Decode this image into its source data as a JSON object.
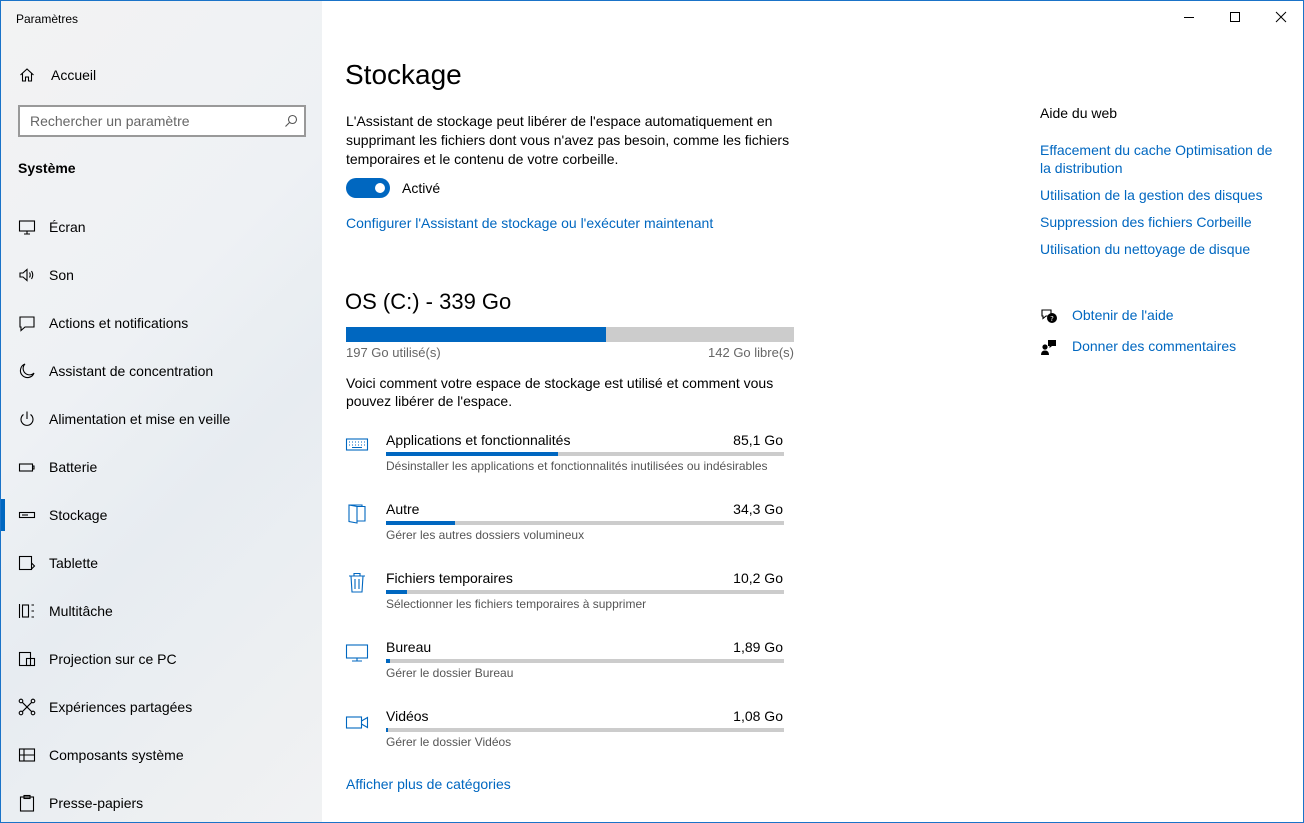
{
  "window": {
    "title": "Paramètres",
    "controls": [
      "minimize",
      "maximize",
      "close"
    ]
  },
  "sidebar": {
    "home_label": "Accueil",
    "search_placeholder": "Rechercher un paramètre",
    "section": "Système",
    "items": [
      {
        "label": "Écran",
        "icon": "monitor-icon"
      },
      {
        "label": "Son",
        "icon": "speaker-icon"
      },
      {
        "label": "Actions et notifications",
        "icon": "notification-icon"
      },
      {
        "label": "Assistant de concentration",
        "icon": "moon-icon"
      },
      {
        "label": "Alimentation et mise en veille",
        "icon": "power-icon"
      },
      {
        "label": "Batterie",
        "icon": "battery-icon"
      },
      {
        "label": "Stockage",
        "icon": "storage-icon",
        "active": true
      },
      {
        "label": "Tablette",
        "icon": "tablet-icon"
      },
      {
        "label": "Multitâche",
        "icon": "multitask-icon"
      },
      {
        "label": "Projection sur ce PC",
        "icon": "projection-icon"
      },
      {
        "label": "Expériences partagées",
        "icon": "share-icon"
      },
      {
        "label": "Composants système",
        "icon": "components-icon"
      },
      {
        "label": "Presse-papiers",
        "icon": "clipboard-icon"
      }
    ]
  },
  "main": {
    "title": "Stockage",
    "description": "L'Assistant de stockage peut libérer de l'espace automatiquement en supprimant les fichiers dont vous n'avez pas besoin, comme les fichiers temporaires et le contenu de votre corbeille.",
    "toggle": {
      "state": "on",
      "label": "Activé"
    },
    "configure_link": "Configurer l'Assistant de stockage ou l'exécuter maintenant",
    "drive": {
      "title": "OS (C:) - 339 Go",
      "used_label": "197 Go utilisé(s)",
      "free_label": "142 Go libre(s)",
      "used_fraction": 0.581
    },
    "usage_description": "Voici comment votre espace de stockage est utilisé et comment vous pouvez libérer de l'espace.",
    "categories": [
      {
        "name": "Applications et fonctionnalités",
        "size": "85,1 Go",
        "sub": "Désinstaller les applications et fonctionnalités inutilisées ou indésirables",
        "fraction": 0.432,
        "icon": "keyboard-icon"
      },
      {
        "name": "Autre",
        "size": "34,3 Go",
        "sub": "Gérer les autres dossiers volumineux",
        "fraction": 0.174,
        "icon": "folder-icon"
      },
      {
        "name": "Fichiers temporaires",
        "size": "10,2 Go",
        "sub": "Sélectionner les fichiers temporaires à supprimer",
        "fraction": 0.052,
        "icon": "trash-icon"
      },
      {
        "name": "Bureau",
        "size": "1,89 Go",
        "sub": "Gérer le dossier Bureau",
        "fraction": 0.01,
        "icon": "desktop-icon"
      },
      {
        "name": "Vidéos",
        "size": "1,08 Go",
        "sub": "Gérer le dossier Vidéos",
        "fraction": 0.006,
        "icon": "video-icon"
      }
    ],
    "more_link": "Afficher plus de catégories"
  },
  "right": {
    "help_title": "Aide du web",
    "help_links": [
      "Effacement du cache Optimisation de la distribution",
      "Utilisation de la gestion des disques",
      "Suppression des fichiers Corbeille",
      "Utilisation du nettoyage de disque"
    ],
    "get_help": "Obtenir de l'aide",
    "feedback": "Donner des commentaires"
  },
  "colors": {
    "accent": "#0067c0",
    "bar_track": "#cccccc",
    "sidebar_bg": "#f0f2f4"
  }
}
